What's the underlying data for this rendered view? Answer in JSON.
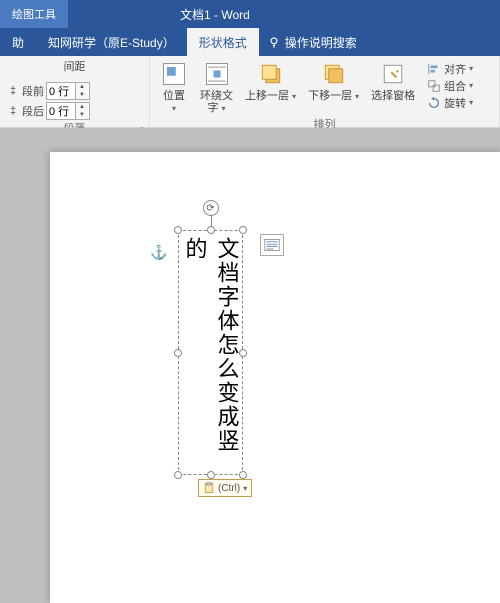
{
  "title": {
    "tools_context": "绘图工具",
    "doc_name": "文档1 - Word"
  },
  "tabs": {
    "help": "助",
    "estudy": "知网研学（原E-Study）",
    "shape_format": "形状格式",
    "tell_me": "操作说明搜索"
  },
  "ribbon": {
    "spacing": {
      "header": "间距",
      "before_label": "段前",
      "before_value": "0 行",
      "after_label": "段后",
      "after_value": "0 行",
      "group_label": "段落"
    },
    "arrange": {
      "position": "位置",
      "wrap": "环绕文\n字",
      "bring_forward": "上移一层",
      "send_backward": "下移一层",
      "selection_pane": "选择窗格",
      "align": "对齐",
      "group": "组合",
      "rotate": "旋转",
      "group_label": "排列"
    }
  },
  "document": {
    "textbox_content": "文档字体怎么变成竖的",
    "ctrl_label": "(Ctrl)"
  }
}
